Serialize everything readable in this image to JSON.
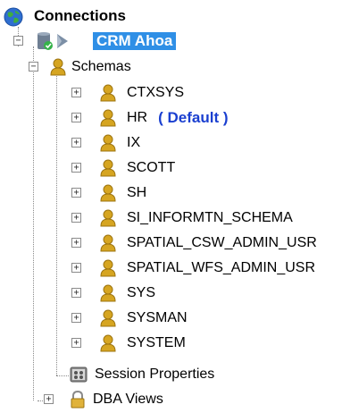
{
  "root": {
    "label": "Connections",
    "icon": "globe-icon"
  },
  "connection": {
    "label": "CRM Ahoa",
    "icon": "database-connected-icon"
  },
  "schemas_folder": {
    "label": "Schemas",
    "icon": "user-icon"
  },
  "schemas": [
    {
      "label": "CTXSYS",
      "tag": ""
    },
    {
      "label": "HR",
      "tag": "( Default )"
    },
    {
      "label": "IX",
      "tag": ""
    },
    {
      "label": "SCOTT",
      "tag": ""
    },
    {
      "label": "SH",
      "tag": ""
    },
    {
      "label": "SI_INFORMTN_SCHEMA",
      "tag": ""
    },
    {
      "label": "SPATIAL_CSW_ADMIN_USR",
      "tag": ""
    },
    {
      "label": "SPATIAL_WFS_ADMIN_USR",
      "tag": ""
    },
    {
      "label": "SYS",
      "tag": ""
    },
    {
      "label": "SYSMAN",
      "tag": ""
    },
    {
      "label": "SYSTEM",
      "tag": ""
    }
  ],
  "session_properties": {
    "label": "Session Properties",
    "icon": "session-properties-icon"
  },
  "dba_views": {
    "label": "DBA Views",
    "icon": "lock-icon"
  },
  "colors": {
    "selection": "#2f8fe6",
    "default_tag": "#1a3fd0"
  }
}
